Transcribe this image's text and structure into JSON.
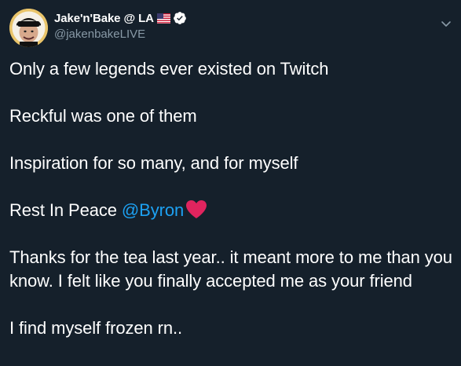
{
  "tweet": {
    "author": {
      "display_name": "Jake'n'Bake @ LA",
      "handle": "@jakenbakeLIVE",
      "flag_icon": "us-flag-icon",
      "verified_icon": "verified-badge-icon"
    },
    "menu_icon": "chevron-down-icon",
    "paragraphs": [
      "Only a few legends ever existed on Twitch",
      "Reckful was one of them",
      "Inspiration for so many, and for myself",
      "Thanks for the tea last year.. it meant more to me than you know. I felt like you finally accepted me as your friend",
      "I find myself frozen rn.."
    ],
    "rip_line": {
      "text": "Rest In Peace ",
      "mention": "@Byron",
      "emoji_icon": "red-heart-icon"
    },
    "colors": {
      "background": "#15202b",
      "text": "#ffffff",
      "secondary_text": "#8899a6",
      "link": "#1da1f2",
      "heart": "#e0245e"
    }
  }
}
